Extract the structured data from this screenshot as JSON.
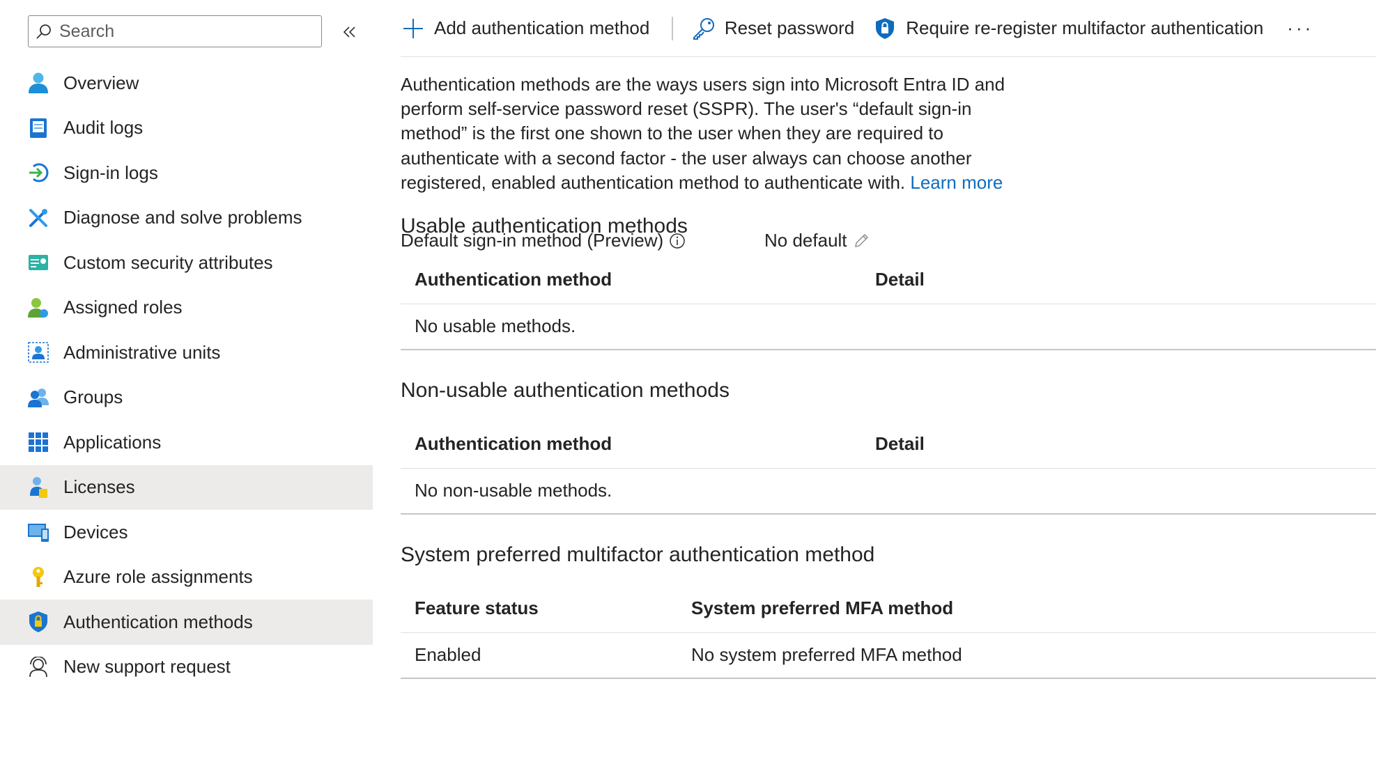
{
  "search": {
    "placeholder": "Search"
  },
  "sidebar": {
    "items": [
      {
        "label": "Overview",
        "icon": "user-icon"
      },
      {
        "label": "Audit logs",
        "icon": "audit-log-icon"
      },
      {
        "label": "Sign-in logs",
        "icon": "sign-in-icon"
      },
      {
        "label": "Diagnose and solve problems",
        "icon": "tools-icon"
      },
      {
        "label": "Custom security attributes",
        "icon": "security-attributes-icon"
      },
      {
        "label": "Assigned roles",
        "icon": "assigned-roles-icon"
      },
      {
        "label": "Administrative units",
        "icon": "administrative-units-icon"
      },
      {
        "label": "Groups",
        "icon": "groups-icon"
      },
      {
        "label": "Applications",
        "icon": "applications-icon"
      },
      {
        "label": "Licenses",
        "icon": "licenses-icon"
      },
      {
        "label": "Devices",
        "icon": "devices-icon"
      },
      {
        "label": "Azure role assignments",
        "icon": "key-icon"
      },
      {
        "label": "Authentication methods",
        "icon": "shield-icon"
      },
      {
        "label": "New support request",
        "icon": "support-icon"
      }
    ],
    "selected": "Authentication methods",
    "hovered": "Licenses"
  },
  "toolbar": {
    "add_label": "Add authentication method",
    "reset_label": "Reset password",
    "require_label": "Require re-register multifactor authentication",
    "more_label": "···"
  },
  "description": {
    "text": "Authentication methods are the ways users sign into Microsoft Entra ID and perform self-service password reset (SSPR). The user's “default sign-in method” is the first one shown to the user when they are required to authenticate with a second factor - the user always can choose another registered, enabled authentication method to authenticate with. ",
    "link": "Learn more"
  },
  "default_method": {
    "label": "Default sign-in method (Preview)",
    "value": "No default"
  },
  "usable": {
    "title": "Usable authentication methods",
    "col1": "Authentication method",
    "col2": "Detail",
    "empty": "No usable methods."
  },
  "non_usable": {
    "title": "Non-usable authentication methods",
    "col1": "Authentication method",
    "col2": "Detail",
    "empty": "No non-usable methods."
  },
  "system_preferred": {
    "title": "System preferred multifactor authentication method",
    "col1": "Feature status",
    "col2": "System preferred MFA method",
    "status": "Enabled",
    "method": "No system preferred MFA method"
  },
  "colors": {
    "accent": "#0f6cbd",
    "selected_bg": "#edebe9",
    "divider": "#e1dfdd"
  }
}
